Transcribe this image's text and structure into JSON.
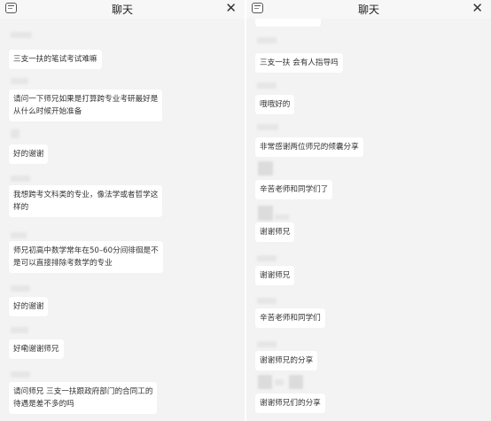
{
  "left": {
    "header": {
      "title": "聊天",
      "close": "✕"
    },
    "messages": [
      {
        "lines": [
          "三支一扶的笔试考试难嘛"
        ]
      },
      {
        "lines": [
          "请问一下师兄如果是打算跨专业考研最好是",
          "从什么时候开始准备"
        ]
      },
      {
        "lines": [
          "好的谢谢"
        ]
      },
      {
        "lines": [
          "我想跨考文科类的专业，像法学或者哲学这",
          "样的"
        ]
      },
      {
        "lines": [
          "师兄初高中数学常年在50–60分间徘徊是不",
          "是可以直接排除考数学的专业"
        ]
      },
      {
        "lines": [
          "好的谢谢"
        ]
      },
      {
        "lines": [
          "好嘞谢谢师兄"
        ]
      },
      {
        "lines": [
          "请问师兄 三支一扶跟政府部门的合同工的",
          "待遇是差不多的吗"
        ]
      }
    ]
  },
  "right": {
    "header": {
      "title": "聊天",
      "close": "✕"
    },
    "messages": [
      {
        "lines": [
          "三支一扶 会有人指导吗"
        ]
      },
      {
        "lines": [
          "哦哦好的"
        ]
      },
      {
        "lines": [
          "非常感谢两位师兄的倾囊分享"
        ]
      },
      {
        "lines": [
          "辛苦老师和同学们了"
        ]
      },
      {
        "lines": [
          "谢谢师兄"
        ]
      },
      {
        "lines": [
          "谢谢师兄"
        ]
      },
      {
        "lines": [
          "辛苦老师和同学们"
        ]
      },
      {
        "lines": [
          "谢谢师兄的分享"
        ]
      },
      {
        "lines": [
          "谢谢师兄们的分享"
        ]
      }
    ]
  }
}
